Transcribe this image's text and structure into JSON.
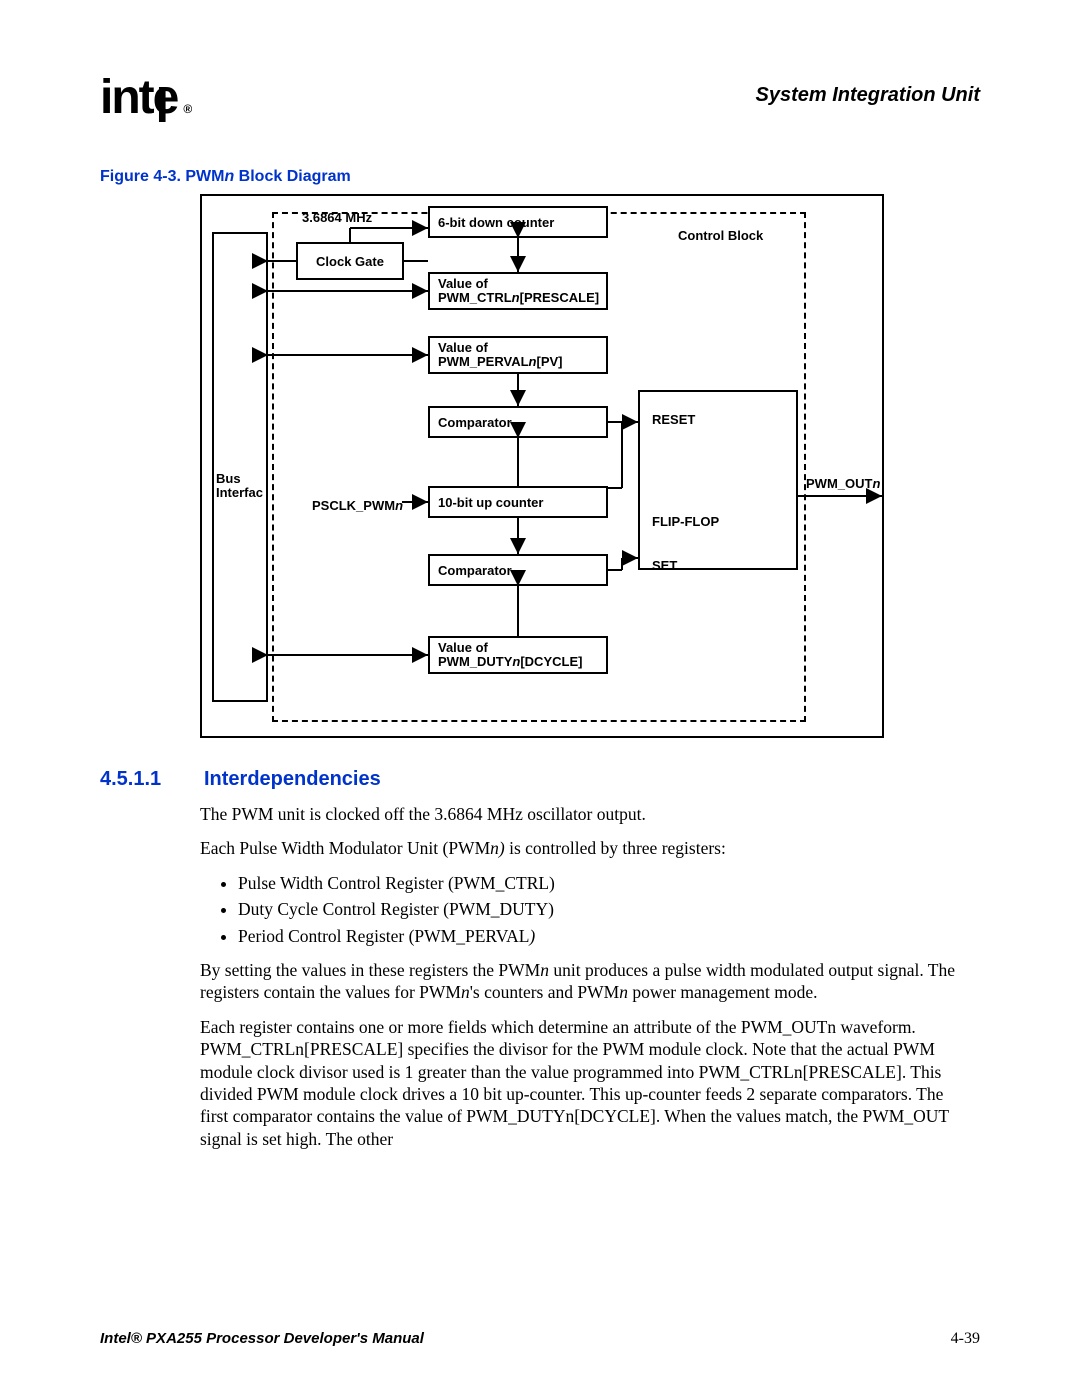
{
  "header": {
    "section_title": "System Integration Unit"
  },
  "figure": {
    "caption_prefix": "Figure 4-3. PWM",
    "caption_ital": "n",
    "caption_suffix": " Block Diagram",
    "mhz": "3.6864 MHz",
    "clock_gate": "Clock Gate",
    "bus_interface": "Bus Interfac",
    "down_counter": "6-bit down counter",
    "presc_l1": "Value of",
    "presc_l2a": "PWM_CTRL",
    "presc_l2b": "n",
    "presc_l2c": "[PRESCALE]",
    "perv_l1": "Value of",
    "perv_l2a": "PWM_PERVAL",
    "perv_l2b": "n",
    "perv_l2c": "[PV]",
    "comp1": "Comparator",
    "up_counter": "10-bit up counter",
    "psclk_a": "PSCLK_PWM",
    "psclk_b": "n",
    "comp2": "Comparator",
    "dcyc_l1": "Value of",
    "dcyc_l2a": "PWM_DUTY",
    "dcyc_l2b": "n",
    "dcyc_l2c": "[DCYCLE]",
    "control_block": "Control Block",
    "reset": "RESET",
    "set": "SET",
    "flipflop": "FLIP-FLOP",
    "out_a": "PWM_OUT",
    "out_b": "n"
  },
  "section": {
    "num": "4.5.1.1",
    "title": "Interdependencies",
    "p1": "The PWM unit is clocked off the 3.6864 MHz oscillator output.",
    "p2a": "Each Pulse Width Modulator Unit (PWM",
    "p2b": "n)",
    "p2c": " is controlled by three registers:",
    "li1": "Pulse Width Control Register (PWM_CTRL)",
    "li2": "Duty Cycle Control Register (PWM_DUTY)",
    "li3a": "Period Control Register (PWM_PERVAL",
    "li3b": ")",
    "p3a": "By setting the values in these registers the PWM",
    "p3b": "n",
    "p3c": " unit produces a pulse width modulated output signal. The registers contain the values for PWM",
    "p3d": "n",
    "p3e": "'s counters and PWM",
    "p3f": "n",
    "p3g": " power management mode.",
    "p4": "Each register contains one or more fields which determine an attribute of the PWM_OUTn waveform. PWM_CTRLn[PRESCALE] specifies the divisor for the PWM module clock. Note that the actual PWM module clock divisor used is 1 greater than the value programmed into PWM_CTRLn[PRESCALE]. This divided PWM module clock drives a 10 bit up-counter. This up-counter feeds 2 separate comparators. The first comparator contains the value of PWM_DUTYn[DCYCLE]. When the values match, the PWM_OUT signal is set high. The other"
  },
  "footer": {
    "left": "Intel® PXA255 Processor Developer's Manual",
    "right": "4-39"
  }
}
